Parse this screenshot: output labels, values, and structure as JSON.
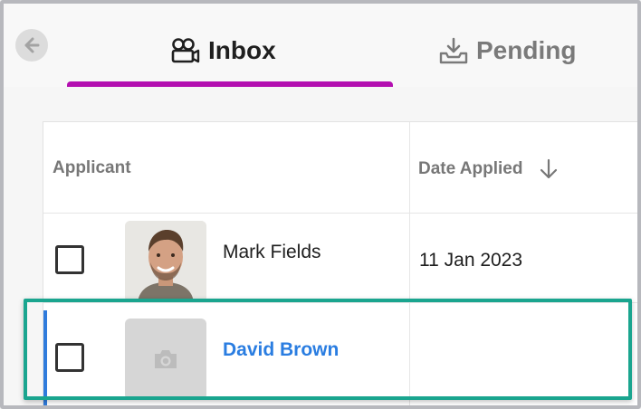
{
  "header": {
    "back_icon": "arrow-left-icon",
    "tabs": [
      {
        "label": "Inbox",
        "icon": "video-camera-icon",
        "active": true
      },
      {
        "label": "Pending",
        "icon": "inbox-tray-download-icon",
        "active": false
      }
    ],
    "active_color": "#b30fb0"
  },
  "table": {
    "columns": [
      {
        "label": "Applicant"
      },
      {
        "label": "Date Applied",
        "sort": "descending",
        "sort_icon": "arrow-down-icon"
      }
    ],
    "rows": [
      {
        "name": "Mark Fields",
        "date": "11 Jan 2023",
        "avatar": "photo",
        "selected": false
      },
      {
        "name": "David Brown",
        "date": "",
        "avatar": "camera-placeholder-icon",
        "selected": true
      }
    ]
  },
  "colors": {
    "link": "#2a7de1",
    "selected_bar": "#2f7bdc",
    "highlight": "#1aa58f"
  }
}
